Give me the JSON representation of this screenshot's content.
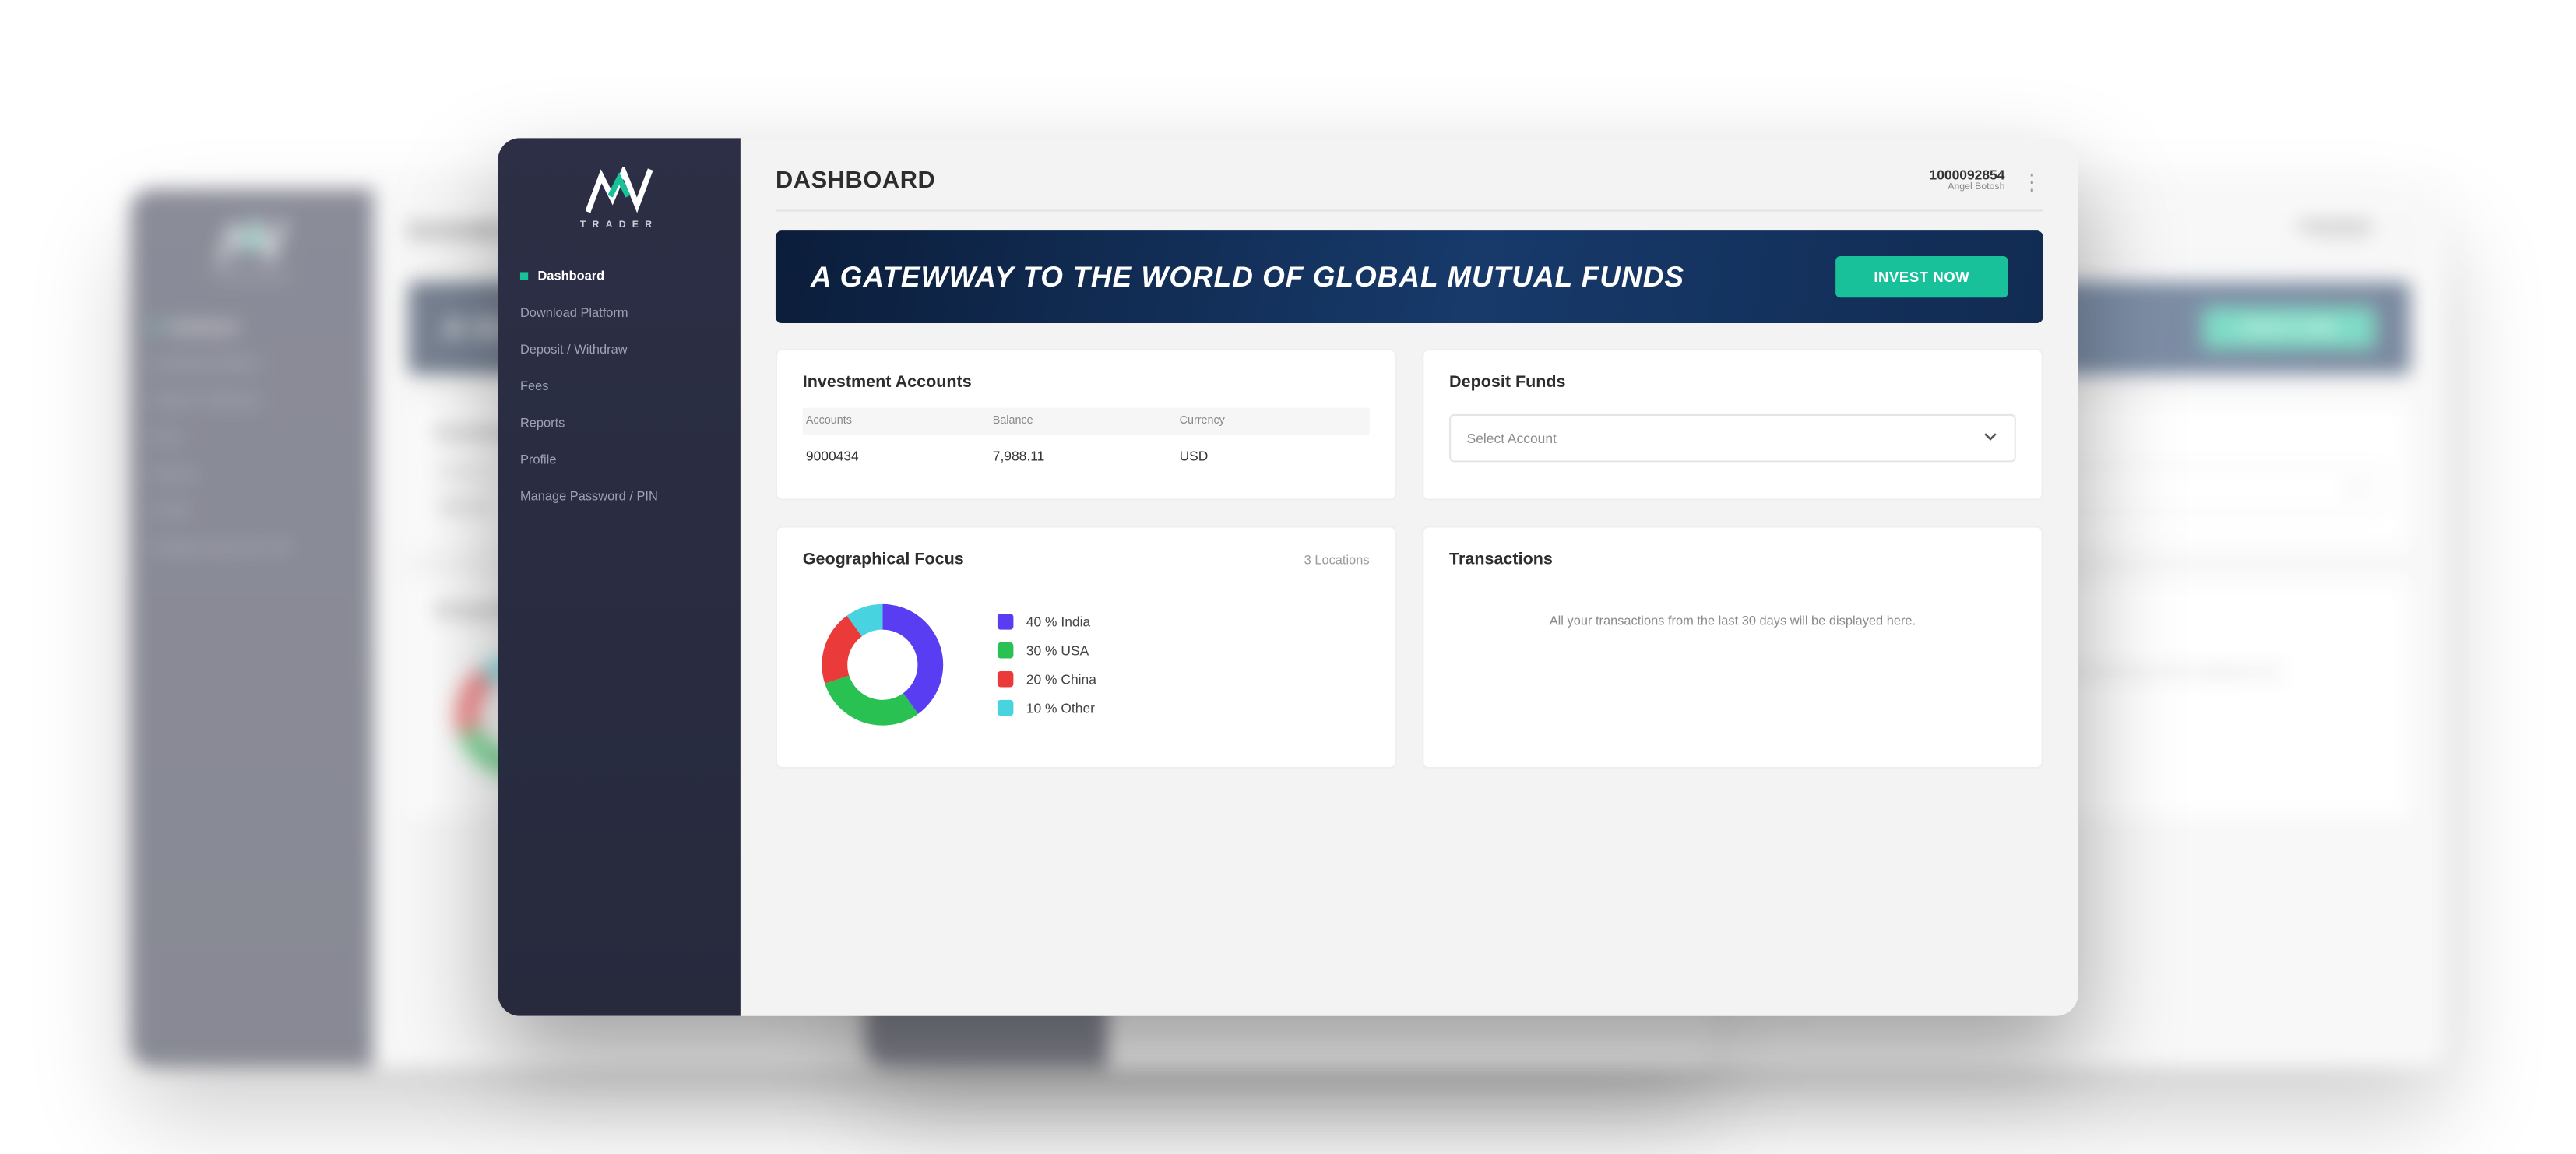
{
  "brand": {
    "name": "MF",
    "tagline": "TRADER"
  },
  "sidebar": {
    "items": [
      {
        "label": "Dashboard",
        "active": true
      },
      {
        "label": "Download Platform"
      },
      {
        "label": "Deposit / Withdraw"
      },
      {
        "label": "Fees"
      },
      {
        "label": "Reports"
      },
      {
        "label": "Profile"
      },
      {
        "label": "Manage Password / PIN"
      }
    ]
  },
  "header": {
    "title": "DASHBOARD",
    "user_id": "1000092854",
    "user_name": "Angel Botosh"
  },
  "banner": {
    "headline": "A GATEWWAY TO THE WORLD OF GLOBAL MUTUAL FUNDS",
    "cta": "INVEST NOW"
  },
  "investment": {
    "title": "Investment Accounts",
    "columns": [
      "Accounts",
      "Balance",
      "Currency"
    ],
    "rows": [
      {
        "account": "9000434",
        "balance": "7,988.11",
        "currency": "USD"
      }
    ]
  },
  "deposit": {
    "title": "Deposit Funds",
    "placeholder": "Select Account"
  },
  "geo": {
    "title": "Geographical Focus",
    "subtitle": "3 Locations"
  },
  "transactions": {
    "title": "Transactions",
    "empty": "All your transactions from the last 30 days will be displayed here."
  },
  "chart_data": {
    "type": "pie",
    "title": "Geographical Focus",
    "series": [
      {
        "name": "India",
        "value": 40,
        "color": "#593df2",
        "label": "40 % India"
      },
      {
        "name": "USA",
        "value": 30,
        "color": "#28c152",
        "label": "30 % USA"
      },
      {
        "name": "China",
        "value": 20,
        "color": "#ea3b3a",
        "label": "20 % China"
      },
      {
        "name": "Other",
        "value": 10,
        "color": "#47d3e0",
        "label": "10 % Other"
      }
    ]
  }
}
